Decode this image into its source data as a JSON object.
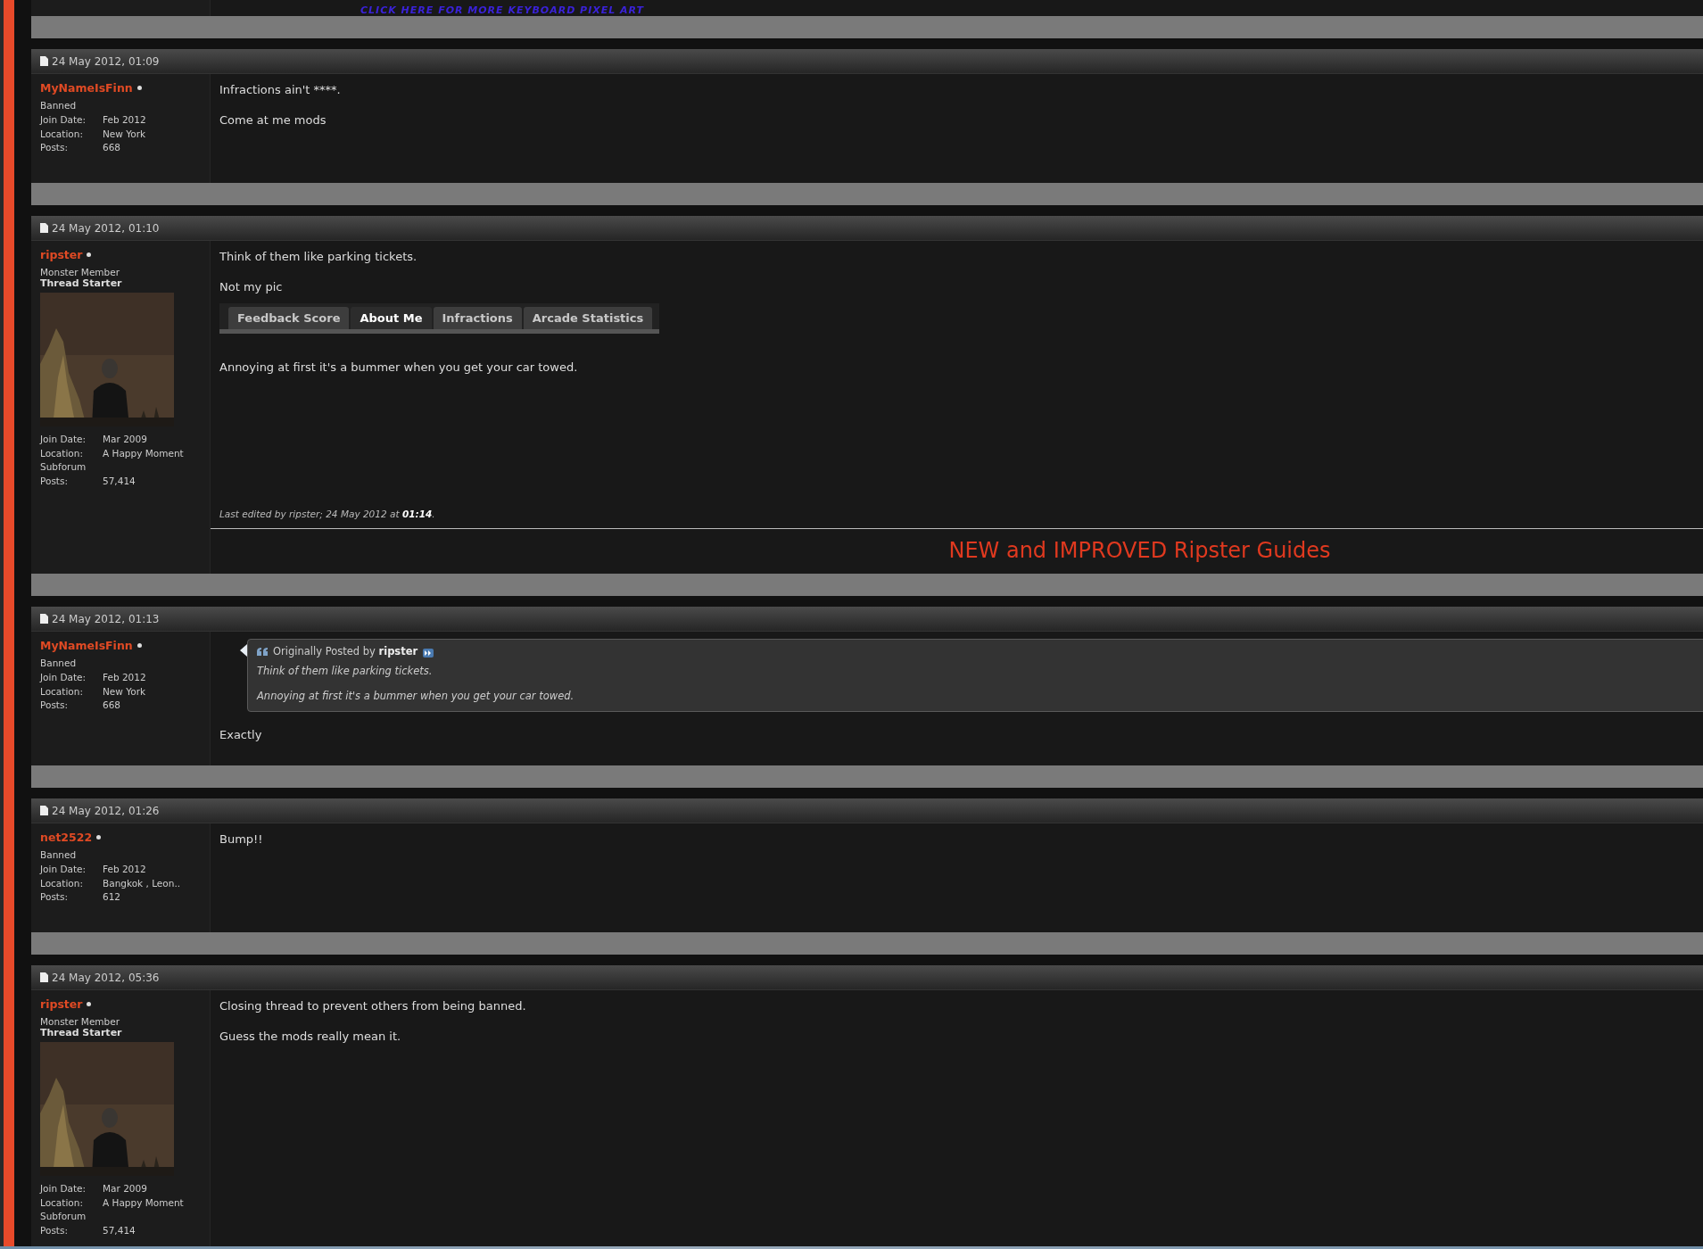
{
  "top_banner": {
    "link": "CLICK HERE FOR MORE KEYBOARD PIXEL ART"
  },
  "posts": [
    {
      "date": "24 May 2012, 01:09",
      "user": {
        "name": "MyNameIsFinn",
        "rank": "Banned",
        "details": [
          {
            "label": "Join Date:",
            "value": "Feb 2012"
          },
          {
            "label": "Location:",
            "value": "New York"
          },
          {
            "label": "Posts:",
            "value": "668"
          }
        ]
      },
      "content": [
        {
          "kind": "text",
          "text": "Infractions ain't ****."
        },
        {
          "kind": "text",
          "text": "Come at me mods"
        }
      ]
    },
    {
      "date": "24 May 2012, 01:10",
      "user": {
        "name": "ripster",
        "rank": "Monster Member",
        "starter": "Thread Starter",
        "details": [
          {
            "label": "Join Date:",
            "value": "Mar 2009"
          },
          {
            "label": "Location:",
            "value": "A Happy Moment Subforum"
          },
          {
            "label": "Posts:",
            "value": "57,414"
          }
        ]
      },
      "content": [
        {
          "kind": "text",
          "text": "Think of them like parking tickets."
        },
        {
          "kind": "text",
          "text": "Not my pic"
        },
        {
          "kind": "tabs",
          "tabs": [
            {
              "label": "Feedback Score",
              "selected": false
            },
            {
              "label": "About Me",
              "selected": true
            },
            {
              "label": "Infractions",
              "selected": false
            },
            {
              "label": "Arcade Statistics",
              "selected": false
            }
          ]
        },
        {
          "kind": "text",
          "text": "Annoying at first it's a bummer when you get your car towed."
        },
        {
          "kind": "edit_note",
          "text": "Last edited by ripster; 24 May 2012 at **01:14**."
        }
      ],
      "signature": "NEW and IMPROVED Ripster Guides"
    },
    {
      "date": "24 May 2012, 01:13",
      "user": {
        "name": "MyNameIsFinn",
        "rank": "Banned",
        "details": [
          {
            "label": "Join Date:",
            "value": "Feb 2012"
          },
          {
            "label": "Location:",
            "value": "New York"
          },
          {
            "label": "Posts:",
            "value": "668"
          }
        ]
      },
      "content": [
        {
          "kind": "quote",
          "attribution": "Originally Posted by **ripster**",
          "lines": [
            "Think of them like parking tickets.",
            "Annoying at first it's a bummer when you get your car towed."
          ]
        },
        {
          "kind": "text",
          "text": "Exactly"
        }
      ]
    },
    {
      "date": "24 May 2012, 01:26",
      "user": {
        "name": "net2522",
        "rank": "Banned",
        "details": [
          {
            "label": "Join Date:",
            "value": "Feb 2012"
          },
          {
            "label": "Location:",
            "value": "Bangkok , Leon.."
          },
          {
            "label": "Posts:",
            "value": "612"
          }
        ]
      },
      "content": [
        {
          "kind": "text",
          "text": "Bump!!"
        }
      ]
    },
    {
      "date": "24 May 2012, 05:36",
      "user": {
        "name": "ripster",
        "rank": "Monster Member",
        "starter": "Thread Starter",
        "details": [
          {
            "label": "Join Date:",
            "value": "Mar 2009"
          },
          {
            "label": "Location:",
            "value": "A Happy Moment Subforum"
          },
          {
            "label": "Posts:",
            "value": "57,414"
          }
        ]
      },
      "content": [
        {
          "kind": "text",
          "text": "Closing thread to prevent others from being banned."
        },
        {
          "kind": "text",
          "text": "Guess the mods really mean it."
        }
      ]
    }
  ]
}
